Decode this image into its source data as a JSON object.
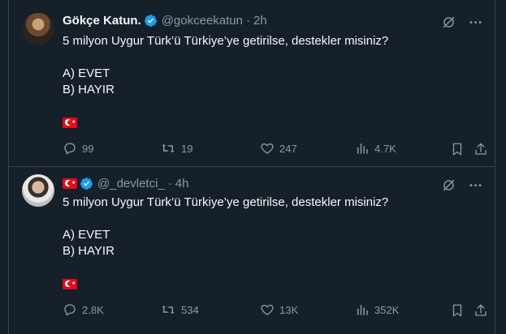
{
  "tweets": [
    {
      "name": "Gökçe Katun.",
      "handle": "@gokceekatun",
      "dot": "·",
      "time": "2h",
      "line1": "5 milyon Uygur Türk’ü Türkiye’ye getirilse, destekler misiniz?",
      "option_a": "A) EVET",
      "option_b": "B) HAYIR",
      "replies": "99",
      "retweets": "19",
      "likes": "247",
      "views": "4.7K"
    },
    {
      "handle": "@_devletci_",
      "dot": "·",
      "time": "4h",
      "line1": "5 milyon Uygur Türk’ü Türkiye’ye getirilse, destekler misiniz?",
      "option_a": "A) EVET",
      "option_b": "B) HAYIR",
      "replies": "2.8K",
      "retweets": "534",
      "likes": "13K",
      "views": "352K"
    }
  ],
  "colors": {
    "background": "#15202b",
    "verified": "#1d9bf0",
    "muted": "#8b98a5",
    "flag_red": "#e30a17"
  }
}
